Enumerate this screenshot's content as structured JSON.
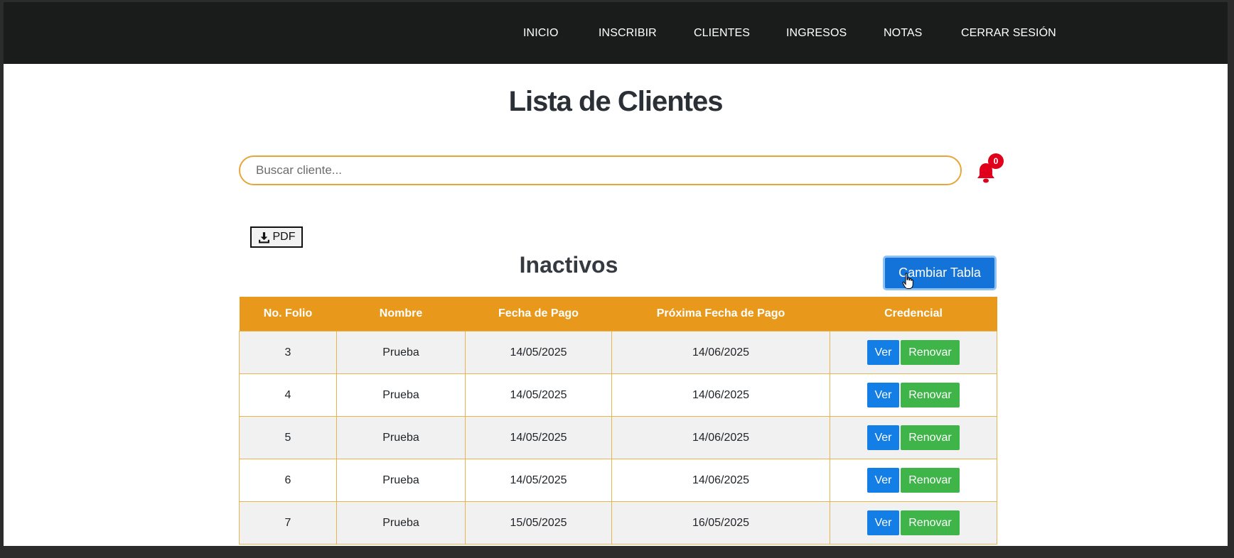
{
  "nav": {
    "items": [
      "INICIO",
      "INSCRIBIR",
      "CLIENTES",
      "INGRESOS",
      "NOTAS",
      "CERRAR SESIÓN"
    ]
  },
  "page": {
    "title": "Lista de Clientes"
  },
  "search": {
    "placeholder": "Buscar cliente...",
    "value": ""
  },
  "notifications": {
    "count": "0",
    "icon": "bell-icon",
    "color": "#e0001b"
  },
  "pdf_button": {
    "label": "PDF",
    "icon": "download-icon"
  },
  "section": {
    "title": "Inactivos"
  },
  "change_button": {
    "label": "Cambiar Tabla"
  },
  "table": {
    "headers": [
      "No. Folio",
      "Nombre",
      "Fecha de Pago",
      "Próxima Fecha de Pago",
      "Credencial"
    ],
    "rows": [
      {
        "folio": "3",
        "nombre": "Prueba",
        "fecha_pago": "14/05/2025",
        "proxima_fecha": "14/06/2025",
        "ver": "Ver",
        "renovar": "Renovar"
      },
      {
        "folio": "4",
        "nombre": "Prueba",
        "fecha_pago": "14/05/2025",
        "proxima_fecha": "14/06/2025",
        "ver": "Ver",
        "renovar": "Renovar"
      },
      {
        "folio": "5",
        "nombre": "Prueba",
        "fecha_pago": "14/05/2025",
        "proxima_fecha": "14/06/2025",
        "ver": "Ver",
        "renovar": "Renovar"
      },
      {
        "folio": "6",
        "nombre": "Prueba",
        "fecha_pago": "14/05/2025",
        "proxima_fecha": "14/06/2025",
        "ver": "Ver",
        "renovar": "Renovar"
      },
      {
        "folio": "7",
        "nombre": "Prueba",
        "fecha_pago": "15/05/2025",
        "proxima_fecha": "16/05/2025",
        "ver": "Ver",
        "renovar": "Renovar"
      }
    ]
  },
  "colors": {
    "nav_bg": "#1a1c1b",
    "accent_orange": "#e8991c",
    "button_blue": "#127ee6",
    "button_green": "#3fb449"
  }
}
